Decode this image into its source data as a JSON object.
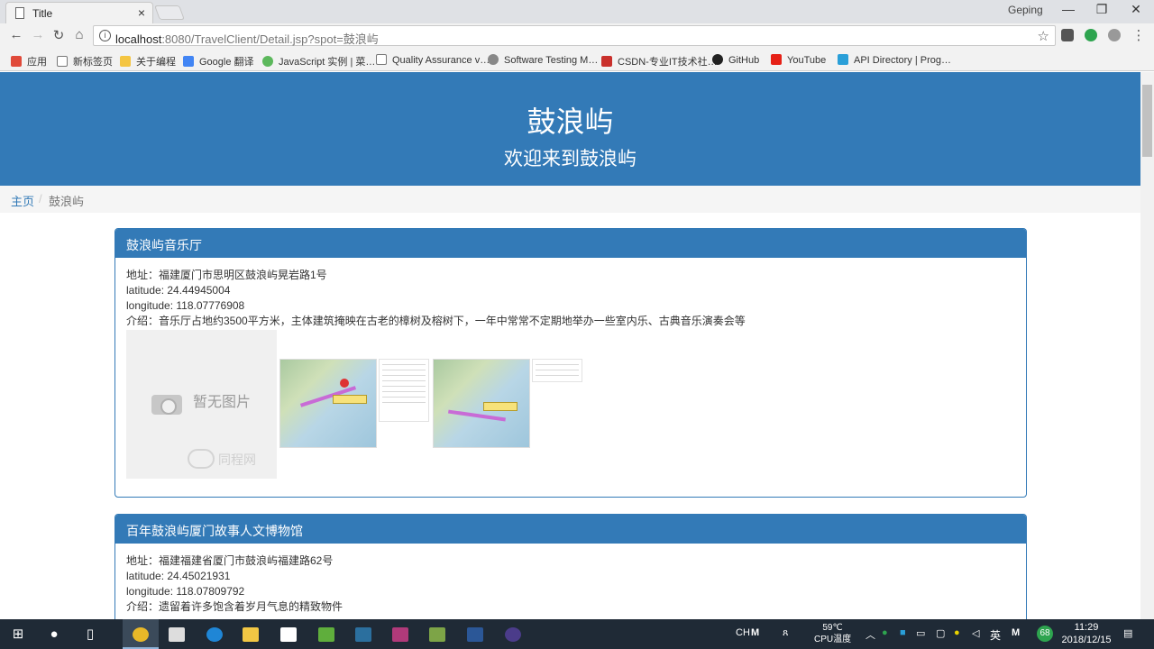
{
  "browser": {
    "tab_title": "Title",
    "tab_close": "×",
    "profile": "Geping",
    "window_controls": [
      "—",
      "❐",
      "✕"
    ],
    "url_host": "localhost",
    "url_path": ":8080/TravelClient/Detail.jsp?spot=鼓浪屿",
    "nav": {
      "back": "←",
      "forward": "→",
      "reload": "↻",
      "home": "⌂",
      "info": "i",
      "star": "☆",
      "menu": "⋮"
    },
    "bookmarks": [
      {
        "label": "应用",
        "icon": "apps-grid-icon",
        "color": "#e04a3a"
      },
      {
        "label": "新标签页",
        "icon": "page-icon",
        "color": "#ffffff"
      },
      {
        "label": "关于编程",
        "icon": "folder-icon",
        "color": "#f4c542"
      },
      {
        "label": "Google 翻译",
        "icon": "google-translate-icon",
        "color": "#4285f4"
      },
      {
        "label": "JavaScript 实例 | 菜…",
        "icon": "runoob-icon",
        "color": "#5cb85c"
      },
      {
        "label": "Quality Assurance v…",
        "icon": "page-icon",
        "color": "#ffffff"
      },
      {
        "label": "Software Testing M…",
        "icon": "ghost-icon",
        "color": "#888888"
      },
      {
        "label": "CSDN-专业IT技术社…",
        "icon": "csdn-icon",
        "color": "#c9302c"
      },
      {
        "label": "GitHub",
        "icon": "github-icon",
        "color": "#222222"
      },
      {
        "label": "YouTube",
        "icon": "youtube-icon",
        "color": "#e62117"
      },
      {
        "label": "API Directory | Prog…",
        "icon": "api-icon",
        "color": "#2a9fd8"
      }
    ]
  },
  "page": {
    "title": "鼓浪屿",
    "subtitle": "欢迎来到鼓浪屿",
    "breadcrumb": {
      "home": "主页",
      "separator": "/",
      "current": "鼓浪屿"
    },
    "no_image_text": "暂无图片",
    "no_image_watermark": "同程网",
    "spots": [
      {
        "name": "鼓浪屿音乐厅",
        "address": "地址：福建厦门市思明区鼓浪屿晃岩路1号",
        "latitude": "latitude: 24.44945004",
        "longitude": "longitude: 118.07776908",
        "intro": "介绍：音乐厅占地约3500平方米，主体建筑掩映在古老的樟树及榕树下，一年中常常不定期地举办一些室内乐、古典音乐演奏会等"
      },
      {
        "name": "百年鼓浪屿厦门故事人文博物馆",
        "address": "地址：福建福建省厦门市鼓浪屿福建路62号",
        "latitude": "latitude: 24.45021931",
        "longitude": "longitude: 118.07809792",
        "intro": "介绍：遗留着许多饱含着岁月气息的精致物件"
      }
    ]
  },
  "taskbar": {
    "temperature": "59℃",
    "temperature_label": "CPU温度",
    "time": "11:29",
    "date": "2018/12/15",
    "ime": "英",
    "ime_ch": "CH",
    "badge": "68",
    "accent": "#3b4a5a"
  },
  "colors": {
    "primary": "#337ab7",
    "breadcrumb_bg": "#f5f5f5"
  }
}
